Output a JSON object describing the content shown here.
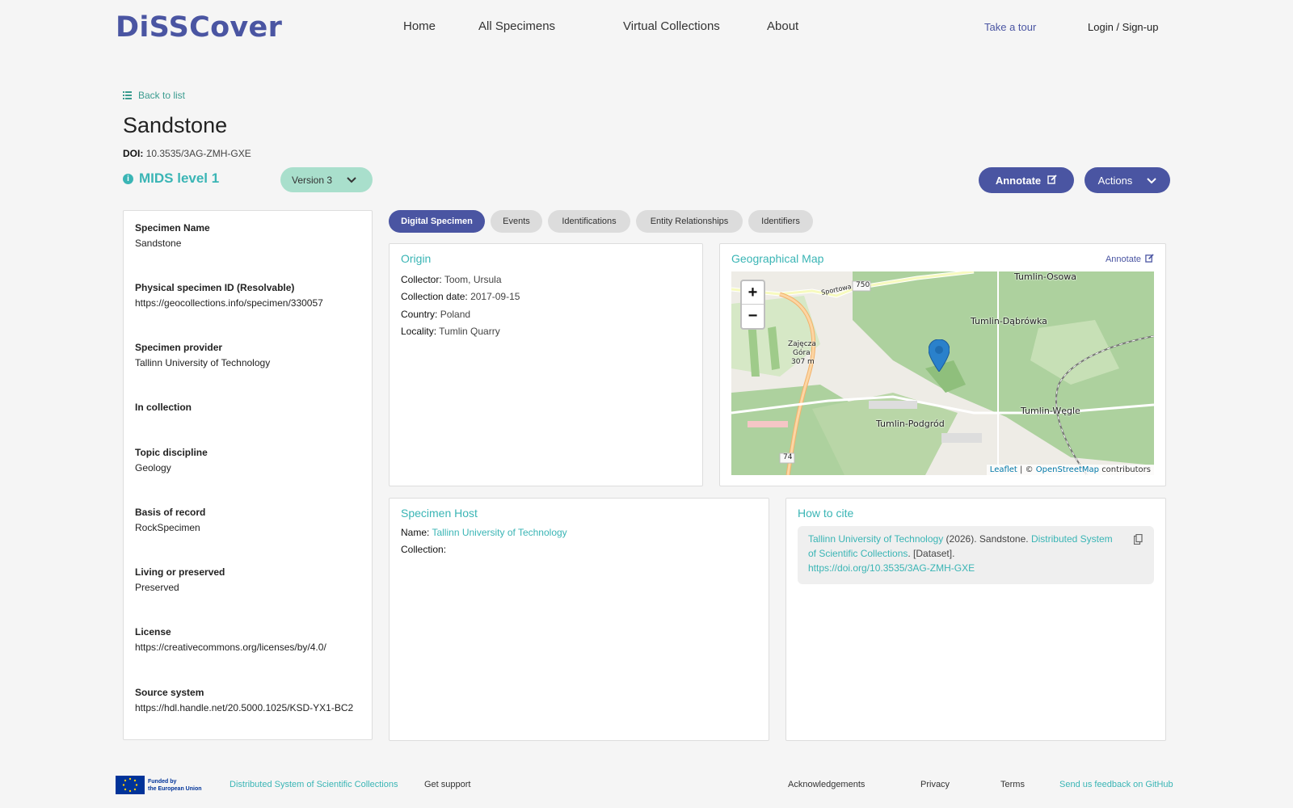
{
  "header": {
    "logo": "DiSSCover",
    "nav": [
      "Home",
      "All Specimens",
      "Virtual Collections",
      "About"
    ],
    "take_tour": "Take a tour",
    "login": "Login / Sign-up"
  },
  "specimen": {
    "back": "Back to list",
    "title": "Sandstone",
    "doi_label": "DOI:",
    "doi_value": "10.3535/3AG-ZMH-GXE",
    "mids": "MIDS level 1",
    "version": "Version 3",
    "annotate": "Annotate",
    "actions": "Actions"
  },
  "fields": [
    {
      "label": "Specimen Name",
      "value": "Sandstone"
    },
    {
      "label": "Physical specimen ID (Resolvable)",
      "value": "https://geocollections.info/specimen/330057"
    },
    {
      "label": "Specimen provider",
      "value": "Tallinn University of Technology"
    },
    {
      "label": "In collection",
      "value": ""
    },
    {
      "label": "Topic discipline",
      "value": "Geology"
    },
    {
      "label": "Basis of record",
      "value": "RockSpecimen"
    },
    {
      "label": "Living or preserved",
      "value": "Preserved"
    },
    {
      "label": "License",
      "value": "https://creativecommons.org/licenses/by/4.0/"
    },
    {
      "label": "Source system",
      "value": "https://hdl.handle.net/20.5000.1025/KSD-YX1-BC2"
    }
  ],
  "tabs": [
    "Digital Specimen",
    "Events",
    "Identifications",
    "Entity Relationships",
    "Identifiers"
  ],
  "origin": {
    "title": "Origin",
    "collector_label": "Collector:",
    "collector": "Toom, Ursula",
    "date_label": "Collection date:",
    "date": "2017-09-15",
    "country_label": "Country:",
    "country": "Poland",
    "locality_label": "Locality:",
    "locality": "Tumlin Quarry"
  },
  "geo_map": {
    "title": "Geographical Map",
    "annotate": "Annotate",
    "zoom_in": "+",
    "zoom_out": "−",
    "labels": {
      "osowa": "Tumlin-Osowa",
      "dabrowka": "Tumlin-Dąbrówka",
      "wegle": "Tumlin-Węgle",
      "podgrod": "Tumlin-Podgród",
      "zajecza": "Zajęcza",
      "gora": "Góra",
      "elev": "307 m",
      "sportowa": "Sportowa",
      "road750": "750",
      "road74": "74"
    },
    "attribution_leaflet": "Leaflet",
    "attribution_sep": "| ©",
    "attribution_osm": "OpenStreetMap",
    "attribution_tail": "contributors"
  },
  "host": {
    "title": "Specimen Host",
    "name_label": "Name:",
    "name": "Tallinn University of Technology",
    "collection_label": "Collection:"
  },
  "cite": {
    "title": "How to cite",
    "org": "Tallinn University of Technology",
    "year_title": " (2026). Sandstone. ",
    "system": "Distributed System of Scientific Collections",
    "dataset": ". [Dataset].",
    "url": "https://doi.org/10.3535/3AG-ZMH-GXE"
  },
  "footer": {
    "eu_line1": "Funded by",
    "eu_line2": "the European Union",
    "dissco": "Distributed System of Scientific Collections",
    "support": "Get support",
    "ack": "Acknowledgements",
    "privacy": "Privacy",
    "terms": "Terms",
    "feedback": "Send us feedback on GitHub"
  },
  "colors": {
    "brand": "#4a55a2",
    "teal": "#3ab5b5",
    "version_bg": "#a9dfcc"
  }
}
